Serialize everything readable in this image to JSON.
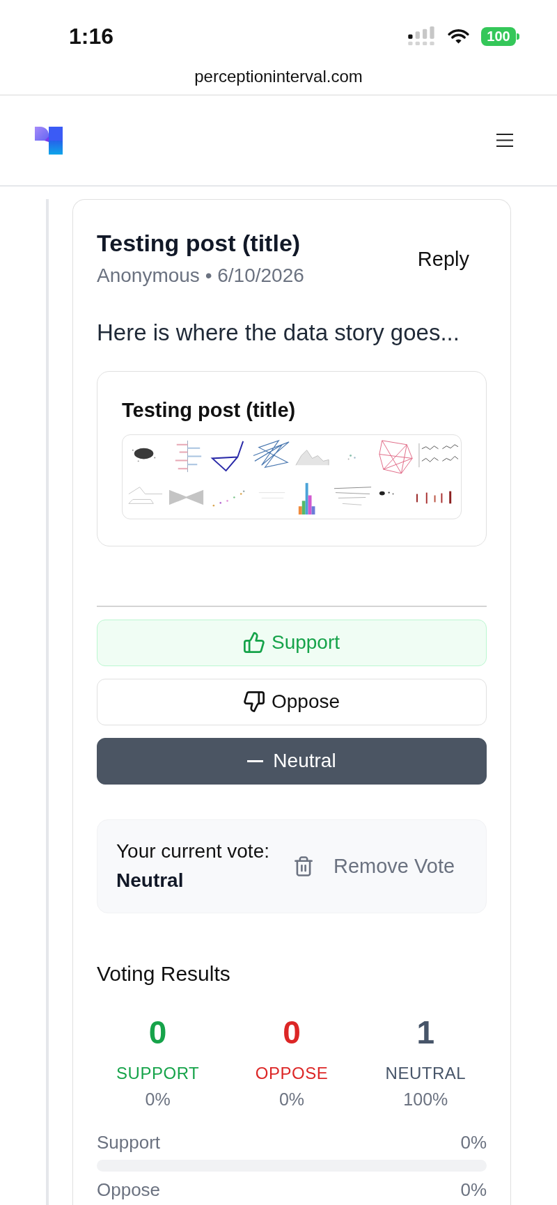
{
  "status_bar": {
    "time": "1:16",
    "battery": "100"
  },
  "browser": {
    "url": "perceptioninterval.com"
  },
  "post": {
    "title": "Testing post (title)",
    "byline": "Anonymous • 6/10/2026",
    "reply": "Reply",
    "body": "Here is where the data story goes...",
    "embed": {
      "title": "Testing post (title)"
    }
  },
  "vote_buttons": [
    {
      "kind": "support",
      "label": "Support",
      "selected": false,
      "highlighted": true
    },
    {
      "kind": "oppose",
      "label": "Oppose",
      "selected": false,
      "highlighted": false
    },
    {
      "kind": "neutral",
      "label": "Neutral",
      "selected": true,
      "highlighted": false
    }
  ],
  "current_vote": {
    "label": "Your current vote:",
    "value": "Neutral",
    "remove": "Remove Vote"
  },
  "results": {
    "title": "Voting Results",
    "stats": [
      {
        "count": "0",
        "label": "SUPPORT",
        "percent": "0%",
        "color": "#16a34a"
      },
      {
        "count": "0",
        "label": "OPPOSE",
        "percent": "0%",
        "color": "#dc2626"
      },
      {
        "count": "1",
        "label": "NEUTRAL",
        "percent": "100%",
        "color": "#475569"
      }
    ],
    "bars": [
      {
        "label": "Support",
        "percent": "0%",
        "level": 0
      },
      {
        "label": "Oppose",
        "percent": "0%"
      }
    ]
  }
}
